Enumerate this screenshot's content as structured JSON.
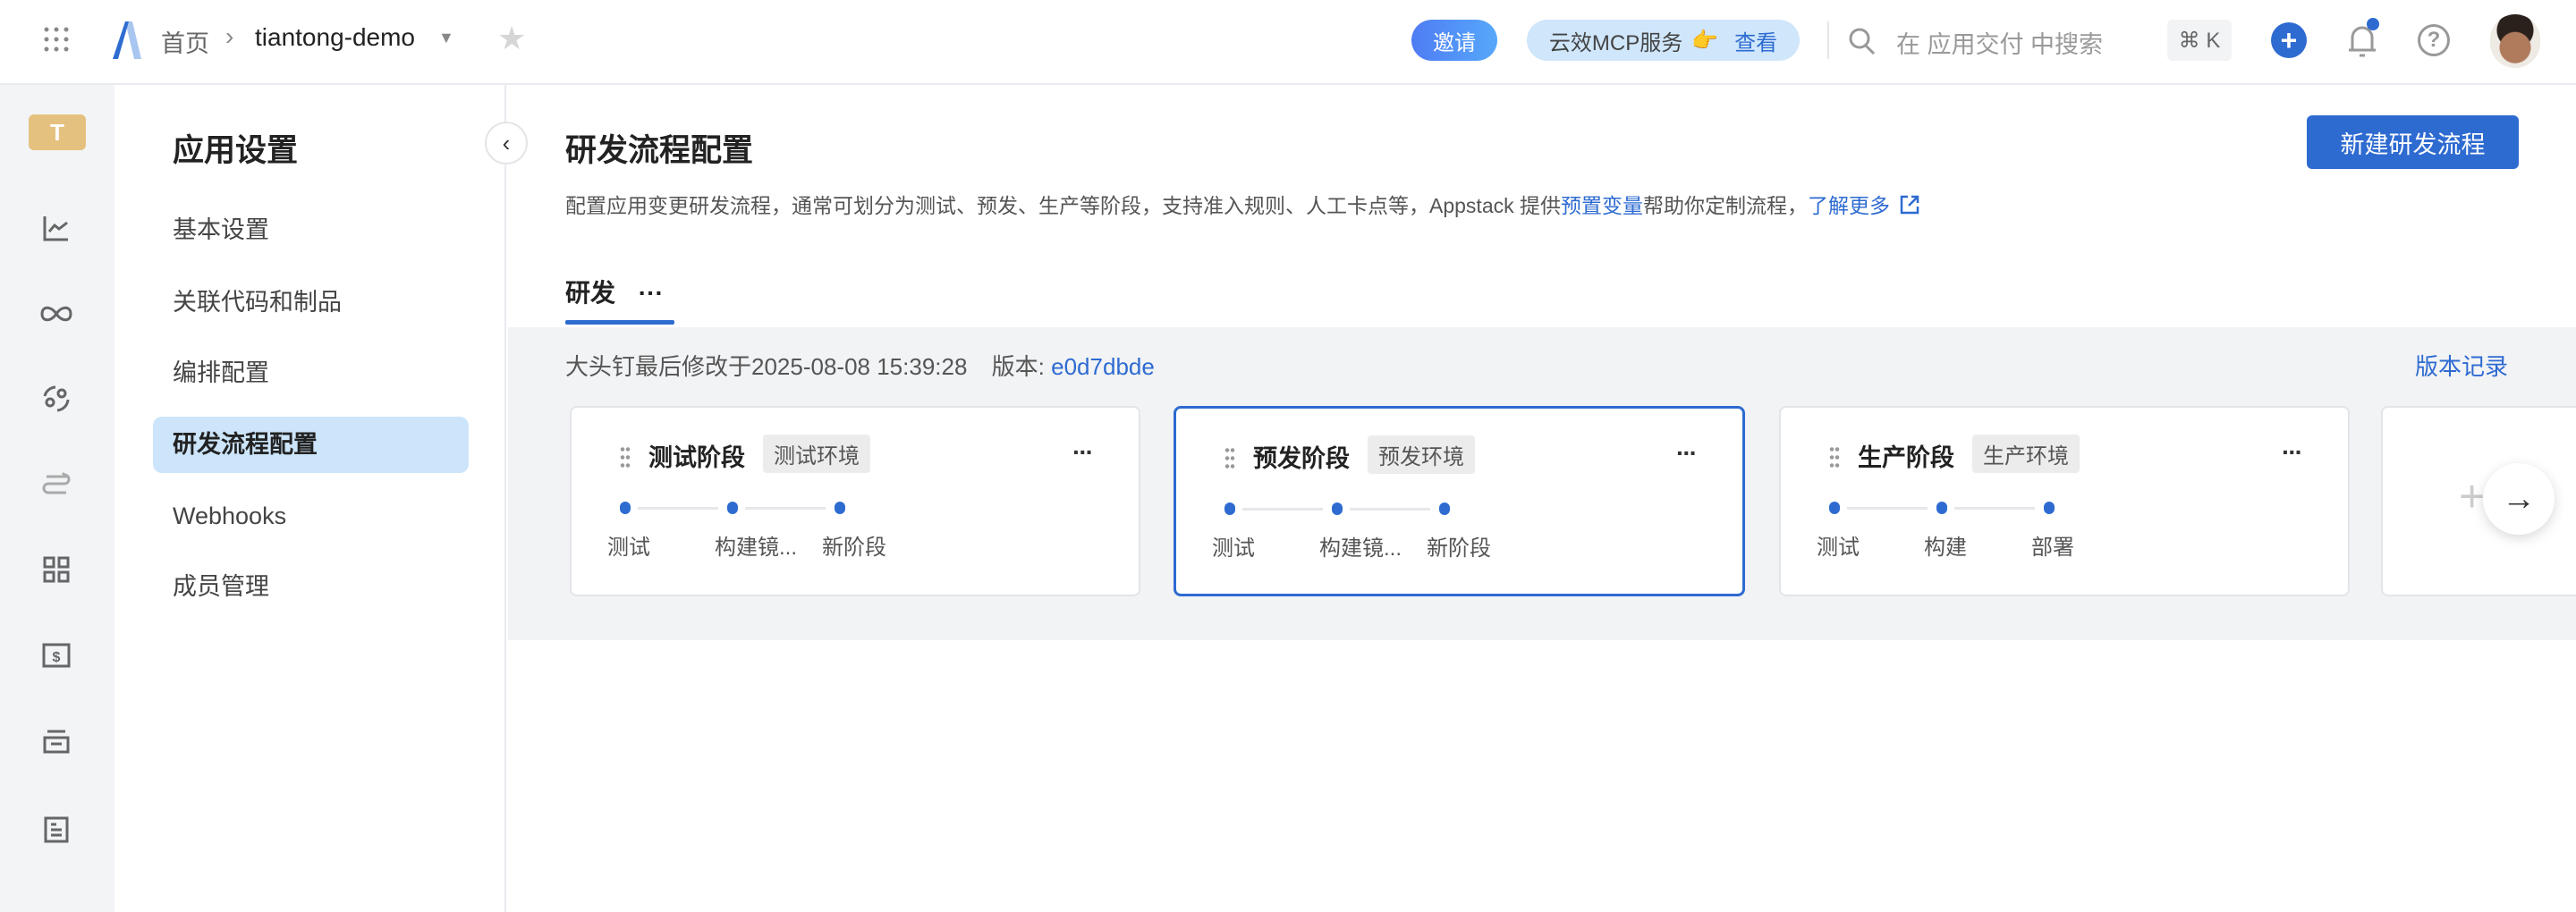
{
  "topbar": {
    "breadcrumb_home": "首页",
    "project_name": "tiantong-demo",
    "invite_label": "邀请",
    "mcp_label": "云效MCP服务",
    "mcp_view": "查看",
    "search_placeholder": "在 应用交付 中搜索",
    "shortcut": "⌘ K"
  },
  "rail": {
    "avatar_letter": "T"
  },
  "sidebar": {
    "title": "应用设置",
    "items": [
      {
        "label": "基本设置"
      },
      {
        "label": "关联代码和制品"
      },
      {
        "label": "编排配置"
      },
      {
        "label": "研发流程配置",
        "active": true
      },
      {
        "label": "Webhooks"
      },
      {
        "label": "成员管理"
      }
    ]
  },
  "main": {
    "title": "研发流程配置",
    "new_button": "新建研发流程",
    "desc_prefix": "配置应用变更研发流程，通常可划分为测试、预发、生产等阶段，支持准入规则、人工卡点等，Appstack 提供",
    "desc_link": "预置变量",
    "desc_suffix": "帮助你定制流程，",
    "learn_more": "了解更多",
    "tab": "研发",
    "tab_more": "···",
    "modified": "大头钉最后修改于2025-08-08 15:39:28",
    "version_label": "版本:",
    "version": "e0d7dbde",
    "history": "版本记录",
    "stages": [
      {
        "name": "测试阶段",
        "env": "测试环境",
        "steps": [
          "测试",
          "构建镜...",
          "新阶段"
        ]
      },
      {
        "name": "预发阶段",
        "env": "预发环境",
        "steps": [
          "测试",
          "构建镜...",
          "新阶段"
        ],
        "selected": true
      },
      {
        "name": "生产阶段",
        "env": "生产环境",
        "steps": [
          "测试",
          "构建",
          "部署"
        ]
      }
    ]
  },
  "colors": {
    "accent": "#2e6bd1",
    "active_bg": "#cce5fb",
    "gray_bg": "#f2f3f5"
  }
}
